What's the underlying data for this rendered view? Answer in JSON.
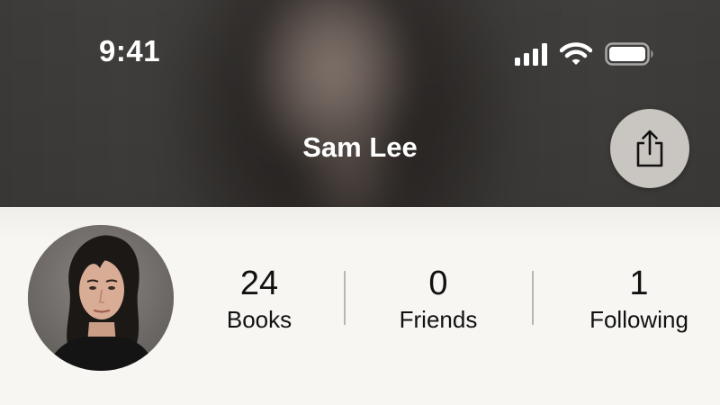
{
  "status_bar": {
    "time": "9:41",
    "icons": [
      "cellular-signal-icon",
      "wifi-icon",
      "battery-icon"
    ]
  },
  "profile": {
    "name": "Sam Lee",
    "share_icon": "share-icon"
  },
  "stats": [
    {
      "value": "24",
      "label": "Books"
    },
    {
      "value": "0",
      "label": "Friends"
    },
    {
      "value": "1",
      "label": "Following"
    }
  ],
  "colors": {
    "header_bg": "#3b3937",
    "page_bg": "#f7f6f3",
    "share_button_bg": "#c9c5c0",
    "text_primary": "#111111",
    "divider": "#b9b7b3"
  }
}
